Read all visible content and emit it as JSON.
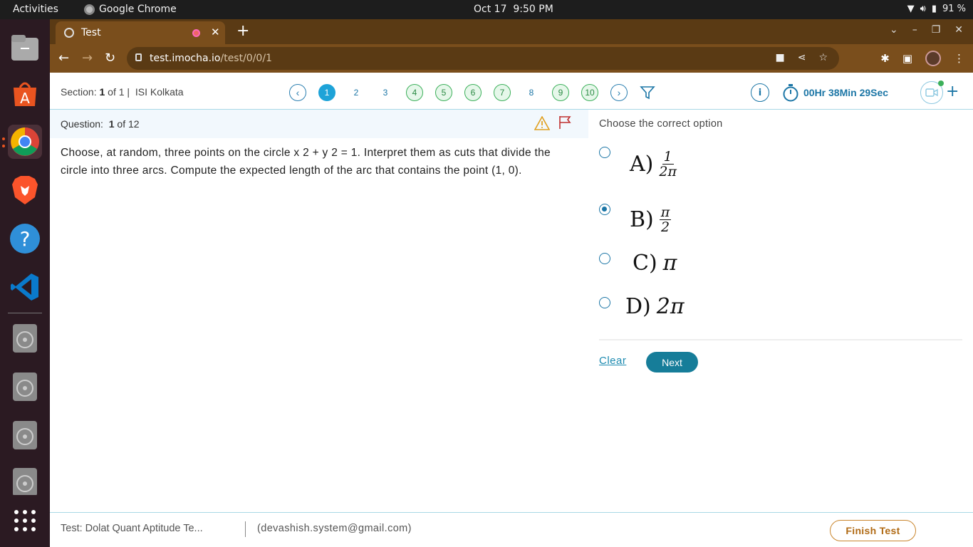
{
  "system": {
    "activities": "Activities",
    "app_name": "Google Chrome",
    "date": "Oct 17",
    "time": "9:50 PM",
    "battery": "91 %"
  },
  "browser": {
    "tab_title": "Test",
    "url_host": "test.imocha.io",
    "url_path": "/test/0/0/1"
  },
  "header": {
    "section_label": "Section:",
    "section_num": "1",
    "section_of": "of 1 |",
    "section_name": "ISI Kolkata",
    "question_nav": [
      {
        "label": "1",
        "state": "current"
      },
      {
        "label": "2",
        "state": "plain"
      },
      {
        "label": "3",
        "state": "plain"
      },
      {
        "label": "4",
        "state": "answered"
      },
      {
        "label": "5",
        "state": "answered"
      },
      {
        "label": "6",
        "state": "answered"
      },
      {
        "label": "7",
        "state": "answered"
      },
      {
        "label": "8",
        "state": "plain"
      },
      {
        "label": "9",
        "state": "answered"
      },
      {
        "label": "10",
        "state": "answered"
      }
    ],
    "info": "i",
    "timer": "00Hr 38Min 29Sec"
  },
  "question": {
    "label": "Question:",
    "number": "1",
    "of_total": "of 12",
    "text": "Choose, at random, three points on the circle x 2 + y 2 = 1. Interpret them as cuts that divide the circle into three arcs. Compute the expected length of the arc that contains the point (1, 0)."
  },
  "options": {
    "prompt": "Choose the correct option",
    "items": [
      {
        "letter": "A)",
        "num": "1",
        "den": "2π",
        "selected": false
      },
      {
        "letter": "B)",
        "num": "π",
        "den": "2",
        "selected": true
      },
      {
        "letter": "C)",
        "expr": "π",
        "selected": false
      },
      {
        "letter": "D)",
        "expr": "2π",
        "selected": false
      }
    ],
    "clear": "Clear",
    "next": "Next"
  },
  "footer": {
    "test_name": "Test: Dolat Quant Aptitude Te...",
    "email": "(devashish.system@gmail.com)",
    "finish": "Finish Test"
  },
  "colors": {
    "accent": "#1c76a6",
    "current_q": "#1ea3d8",
    "answered": "#3cb05a",
    "next_button": "#167d99",
    "finish_border": "#c9852c"
  }
}
